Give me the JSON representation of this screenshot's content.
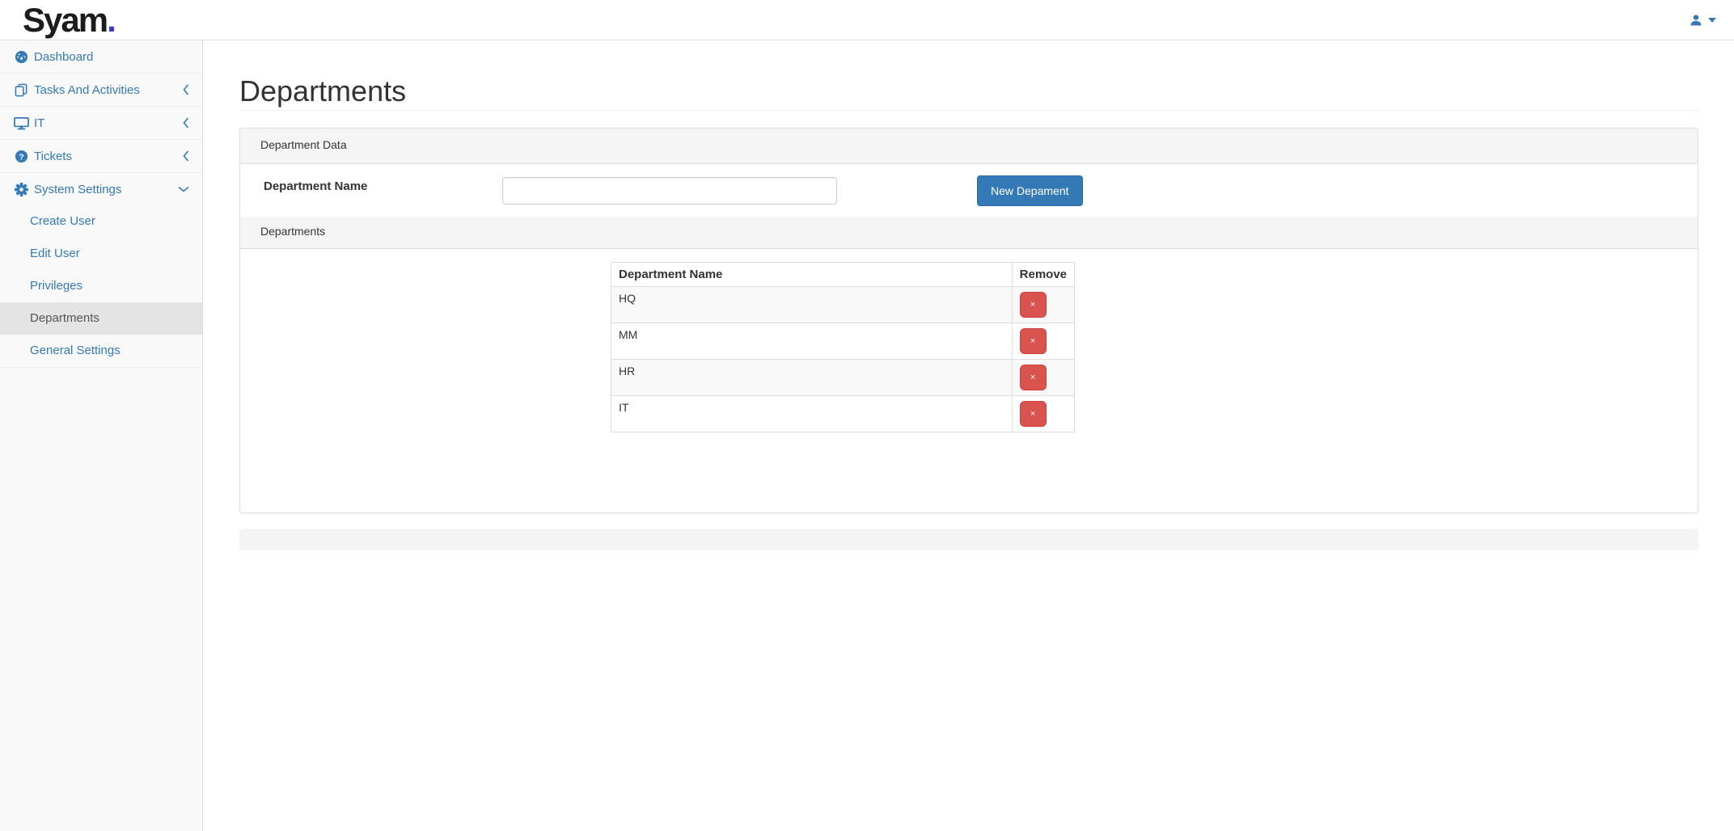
{
  "brand": {
    "name": "Syam",
    "dot": "."
  },
  "topbar": {
    "user_icon": "user-icon",
    "caret_icon": "caret-down-icon"
  },
  "sidebar": {
    "items": [
      {
        "label": "Dashboard",
        "icon": "dashboard-icon",
        "chevron": "none"
      },
      {
        "label": "Tasks And Activities",
        "icon": "tasks-icon",
        "chevron": "left"
      },
      {
        "label": "IT",
        "icon": "desktop-icon",
        "chevron": "left"
      },
      {
        "label": "Tickets",
        "icon": "tickets-icon",
        "chevron": "left"
      },
      {
        "label": "System Settings",
        "icon": "settings-icon",
        "chevron": "down"
      }
    ],
    "system_settings_submenu": [
      {
        "label": "Create User",
        "active": false
      },
      {
        "label": "Edit User",
        "active": false
      },
      {
        "label": "Privileges",
        "active": false
      },
      {
        "label": "Departments",
        "active": true
      },
      {
        "label": "General Settings",
        "active": false
      }
    ]
  },
  "page": {
    "title": "Departments"
  },
  "department_form": {
    "panel_heading": "Department Data",
    "name_label": "Department Name",
    "name_value": "",
    "submit_label": "New Depament"
  },
  "departments_list": {
    "section_heading": "Departments",
    "table": {
      "headers": [
        "Department Name",
        "Remove"
      ],
      "rows": [
        {
          "name": "HQ",
          "remove_label": "×"
        },
        {
          "name": "MM",
          "remove_label": "×"
        },
        {
          "name": "HR",
          "remove_label": "×"
        },
        {
          "name": "IT",
          "remove_label": "×"
        }
      ]
    }
  },
  "colors": {
    "accent_blue": "#337ab7",
    "danger_red": "#d9534f",
    "brand_dot_blue": "#3a3ad6",
    "panel_heading_bg": "#f5f5f5",
    "sidebar_bg": "#f9f9f9"
  }
}
